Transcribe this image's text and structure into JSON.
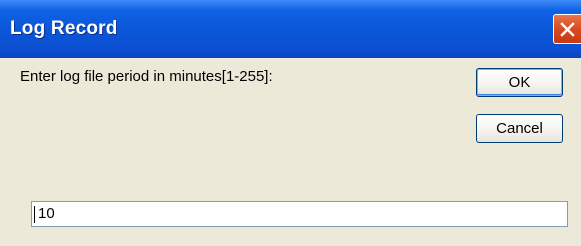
{
  "window": {
    "title": "Log Record",
    "close_icon": "close-icon"
  },
  "dialog": {
    "prompt": "Enter log file period in minutes[1-255]:",
    "ok_label": "OK",
    "cancel_label": "Cancel",
    "input_value": "10"
  },
  "colors": {
    "titlebar": "#0a55d8",
    "background": "#ece9d8",
    "close_button": "#d84a22",
    "button_border": "#003c74",
    "input_border": "#7f9db9"
  }
}
